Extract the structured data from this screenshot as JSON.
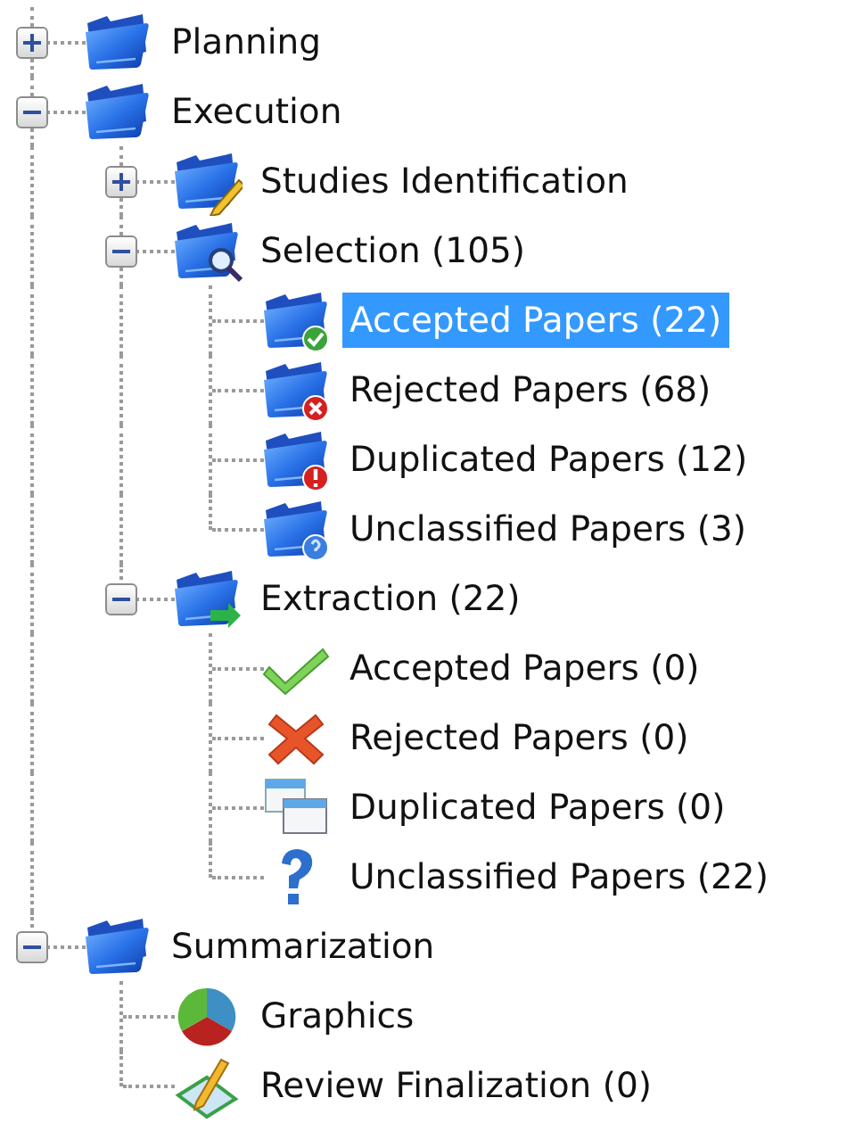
{
  "tree": [
    {
      "label": "Planning",
      "kind": "folder",
      "expanded": false,
      "selected": false
    },
    {
      "label": "Execution",
      "kind": "folder",
      "expanded": true,
      "selected": false,
      "children": [
        {
          "label": "Studies Identification",
          "kind": "folder-pencil",
          "expanded": false,
          "selected": false
        },
        {
          "label": "Selection (105)",
          "kind": "folder-search",
          "expanded": true,
          "selected": false,
          "children": [
            {
              "label": "Accepted Papers (22)",
              "kind": "folder-check",
              "selected": true
            },
            {
              "label": "Rejected Papers (68)",
              "kind": "folder-cross",
              "selected": false
            },
            {
              "label": "Duplicated Papers (12)",
              "kind": "folder-warning",
              "selected": false
            },
            {
              "label": "Unclassified Papers (3)",
              "kind": "folder-question",
              "selected": false
            }
          ]
        },
        {
          "label": "Extraction (22)",
          "kind": "folder-arrow",
          "expanded": true,
          "selected": false,
          "children": [
            {
              "label": "Accepted Papers (0)",
              "kind": "check",
              "selected": false
            },
            {
              "label": "Rejected Papers (0)",
              "kind": "cross",
              "selected": false
            },
            {
              "label": "Duplicated Papers (0)",
              "kind": "windows",
              "selected": false
            },
            {
              "label": "Unclassified Papers (22)",
              "kind": "question",
              "selected": false
            }
          ]
        }
      ]
    },
    {
      "label": "Summarization",
      "kind": "folder",
      "expanded": true,
      "selected": false,
      "children": [
        {
          "label": "Graphics",
          "kind": "pie",
          "selected": false
        },
        {
          "label": "Review Finalization (0)",
          "kind": "pencil-doc",
          "selected": false
        }
      ]
    }
  ]
}
